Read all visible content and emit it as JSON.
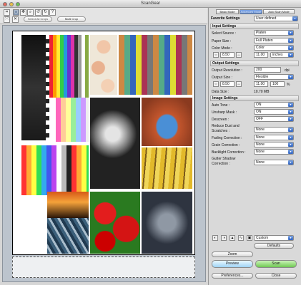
{
  "window": {
    "title": "ScanGear"
  },
  "toolbar": {
    "select_all_crops": "Select All Crops",
    "multi_crop": "Multi Crop"
  },
  "modes": [
    "Basic Mode",
    "Advanced Mode",
    "Auto Scan Mode"
  ],
  "favorite": {
    "label": "Favorite Settings",
    "value": "User defined"
  },
  "input": {
    "title": "Input Settings",
    "select_source_label": "Select Source :",
    "select_source": "Platen",
    "paper_size_label": "Paper Size :",
    "paper_size": "Full Platen",
    "color_mode_label": "Color Mode :",
    "color_mode": "Color",
    "width": "8.50",
    "height": "11.00",
    "unit": "inches"
  },
  "output": {
    "title": "Output Settings",
    "resolution_label": "Output Resolution :",
    "resolution": "200",
    "resolution_unit": "dpi",
    "size_label": "Output Size :",
    "size": "Flexible",
    "width": "8.50",
    "height": "11.00",
    "percent": "100",
    "data_size_label": "Data Size :",
    "data_size": "10.70 MB"
  },
  "image": {
    "title": "Image Settings",
    "rows": [
      {
        "label": "Auto Tone :",
        "value": "ON"
      },
      {
        "label": "Unsharp Mask :",
        "value": "ON"
      },
      {
        "label": "Descreen :",
        "value": "OFF"
      },
      {
        "label": "Reduce Dust and",
        "label2": "Scratches :",
        "value": "None"
      },
      {
        "label": "Fading Correction :",
        "value": "None"
      },
      {
        "label": "Grain Correction :",
        "value": "None"
      },
      {
        "label": "Backlight Correction :",
        "value": "None"
      },
      {
        "label": "Gutter Shadow",
        "label2": "Correction :",
        "value": "None"
      }
    ]
  },
  "bottom": {
    "custom": "Custom",
    "defaults": "Defaults",
    "zoom": "Zoom",
    "preview": "Preview",
    "scan": "Scan",
    "preferences": "Preferences...",
    "close": "Close"
  },
  "colors": {
    "accent": "#3f73c8",
    "scan": "#6fca52",
    "preview": "#9fd4f5"
  }
}
